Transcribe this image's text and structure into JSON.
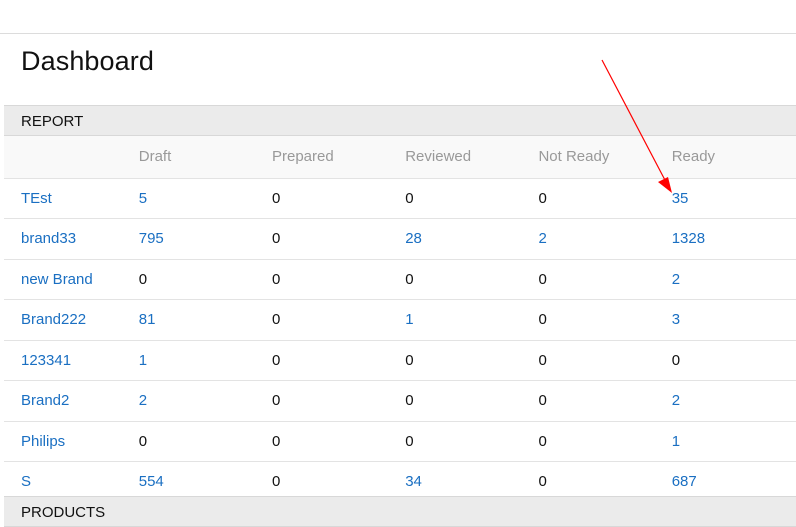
{
  "page": {
    "title": "Dashboard"
  },
  "report": {
    "heading": "REPORT",
    "columns": [
      "",
      "Draft",
      "Prepared",
      "Reviewed",
      "Not Ready",
      "Ready"
    ],
    "rows": [
      {
        "brand": "TEst",
        "draft": "5",
        "prepared": "0",
        "reviewed": "0",
        "not_ready": "0",
        "ready": "35"
      },
      {
        "brand": "brand33",
        "draft": "795",
        "prepared": "0",
        "reviewed": "28",
        "not_ready": "2",
        "ready": "1328"
      },
      {
        "brand": "new Brand",
        "draft": "0",
        "prepared": "0",
        "reviewed": "0",
        "not_ready": "0",
        "ready": "2"
      },
      {
        "brand": "Brand222",
        "draft": "81",
        "prepared": "0",
        "reviewed": "1",
        "not_ready": "0",
        "ready": "3"
      },
      {
        "brand": "123341",
        "draft": "1",
        "prepared": "0",
        "reviewed": "0",
        "not_ready": "0",
        "ready": "0"
      },
      {
        "brand": "Brand2",
        "draft": "2",
        "prepared": "0",
        "reviewed": "0",
        "not_ready": "0",
        "ready": "2"
      },
      {
        "brand": "Philips",
        "draft": "0",
        "prepared": "0",
        "reviewed": "0",
        "not_ready": "0",
        "ready": "1"
      },
      {
        "brand": "S",
        "draft": "554",
        "prepared": "0",
        "reviewed": "34",
        "not_ready": "0",
        "ready": "687"
      }
    ]
  },
  "products": {
    "heading": "PRODUCTS"
  },
  "annotation": {
    "type": "arrow",
    "color": "#ff0000",
    "target": "report.rows.0.ready"
  },
  "colors": {
    "link": "#1a6fc2",
    "header_text": "#999999",
    "panel_heading_bg": "#ebebeb"
  }
}
